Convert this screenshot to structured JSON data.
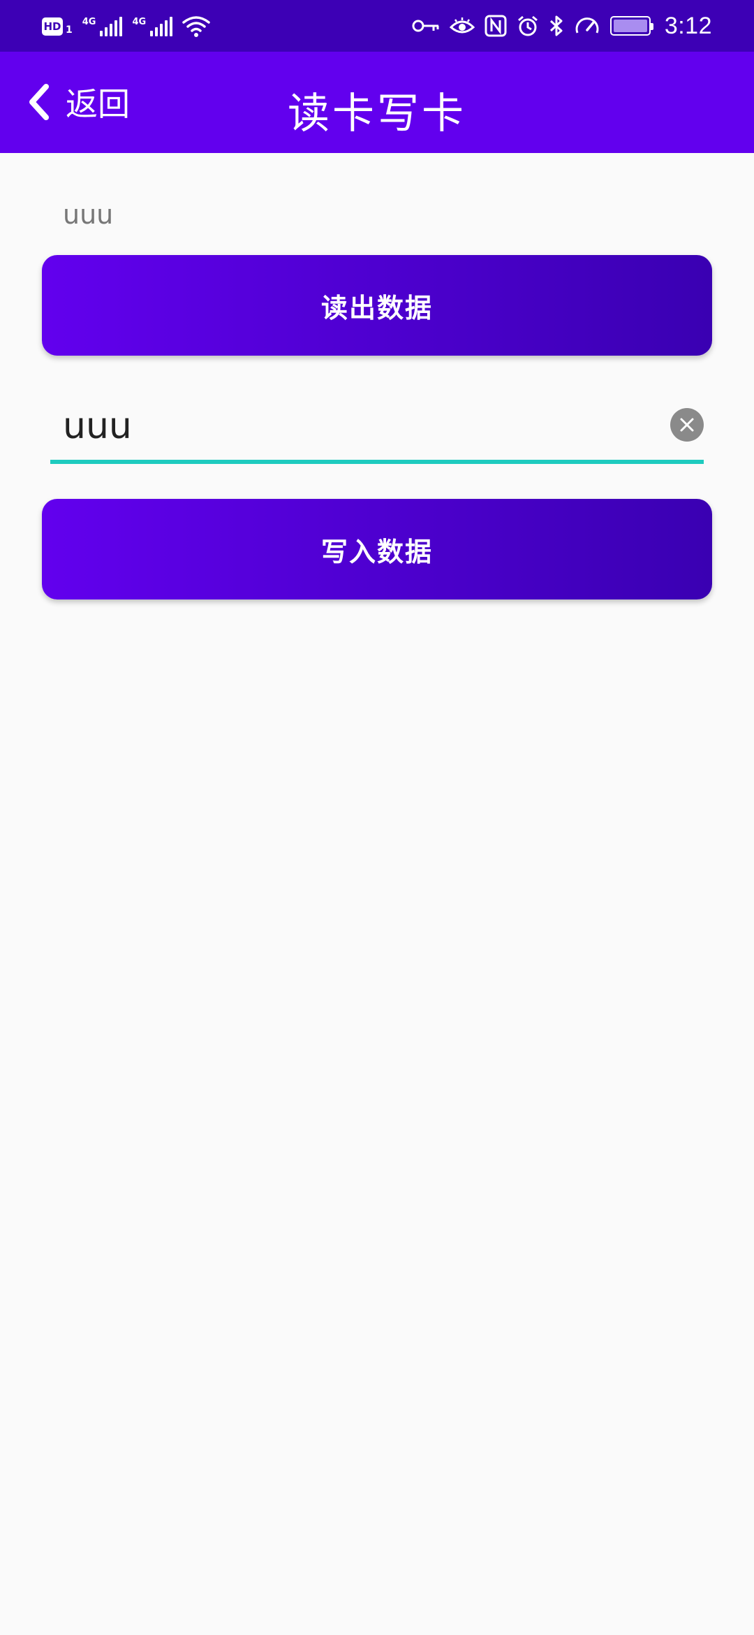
{
  "status_bar": {
    "hd_label": "HD",
    "sim_number": "1",
    "network_1": "4G",
    "network_2": "4G",
    "time": "3:12",
    "battery_level": 1.0,
    "icons": [
      "hd-icon",
      "signal-icon",
      "wifi-icon",
      "key-icon",
      "eye-icon",
      "nfc-icon",
      "alarm-icon",
      "bluetooth-icon",
      "speed-icon",
      "battery-icon"
    ]
  },
  "app_bar": {
    "back_label": "返回",
    "title": "读卡写卡",
    "back_icon": "chevron-left-icon"
  },
  "read_section": {
    "value": "uuu",
    "button_label": "读出数据"
  },
  "write_section": {
    "input_value": "uuu",
    "clear_icon": "clear-icon",
    "button_label": "写入数据"
  },
  "colors": {
    "status_bar": "#3d00b5",
    "app_bar": "#6200ee",
    "button_gradient_start": "#6200ee",
    "button_gradient_end": "#3a00b2",
    "input_underline": "#1ecbbf",
    "background": "#fafafa"
  }
}
